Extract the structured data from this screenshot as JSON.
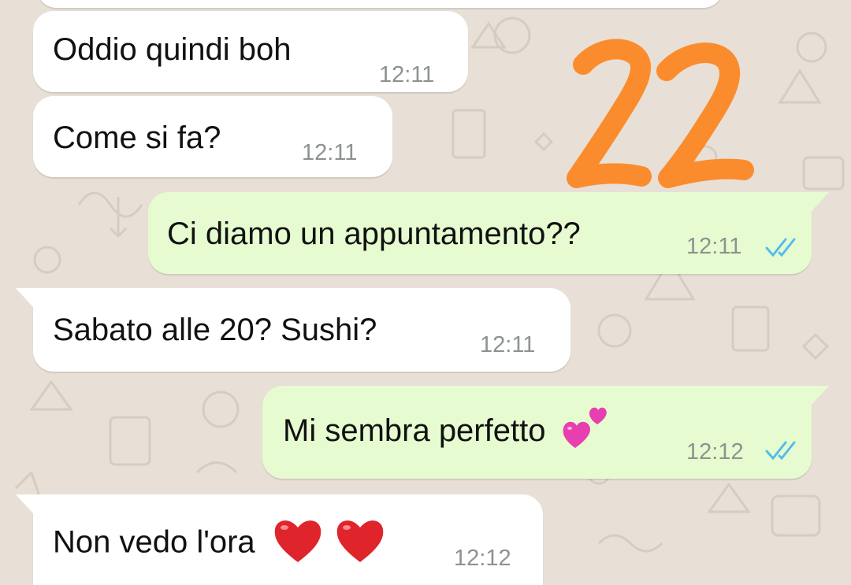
{
  "messages": [
    {
      "id": "m0",
      "direction": "incoming",
      "text": "",
      "time": ""
    },
    {
      "id": "m1",
      "direction": "incoming",
      "text": "Oddio quindi boh",
      "time": "12:11"
    },
    {
      "id": "m2",
      "direction": "incoming",
      "text": "Come si fa?",
      "time": "12:11"
    },
    {
      "id": "m3",
      "direction": "outgoing",
      "text": "Ci diamo un appuntamento??",
      "time": "12:11",
      "status": "read-ticks"
    },
    {
      "id": "m4",
      "direction": "incoming",
      "text": "Sabato alle 20? Sushi?",
      "time": "12:11"
    },
    {
      "id": "m5",
      "direction": "outgoing",
      "text": "Mi sembra perfetto",
      "emoji": "two-hearts",
      "time": "12:12",
      "status": "read-ticks"
    },
    {
      "id": "m6",
      "direction": "incoming",
      "text": "Non vedo l'ora",
      "emoji": "red-heart red-heart",
      "time": "12:12"
    }
  ],
  "overlay": {
    "text": "22",
    "color": "#fb8c2e"
  },
  "colors": {
    "wallpaper": "#e8e0d6",
    "incoming_bubble": "#ffffff",
    "outgoing_bubble": "#e6fcd0",
    "time_text": "#8c9290",
    "read_ticks": "#53bdeb"
  }
}
